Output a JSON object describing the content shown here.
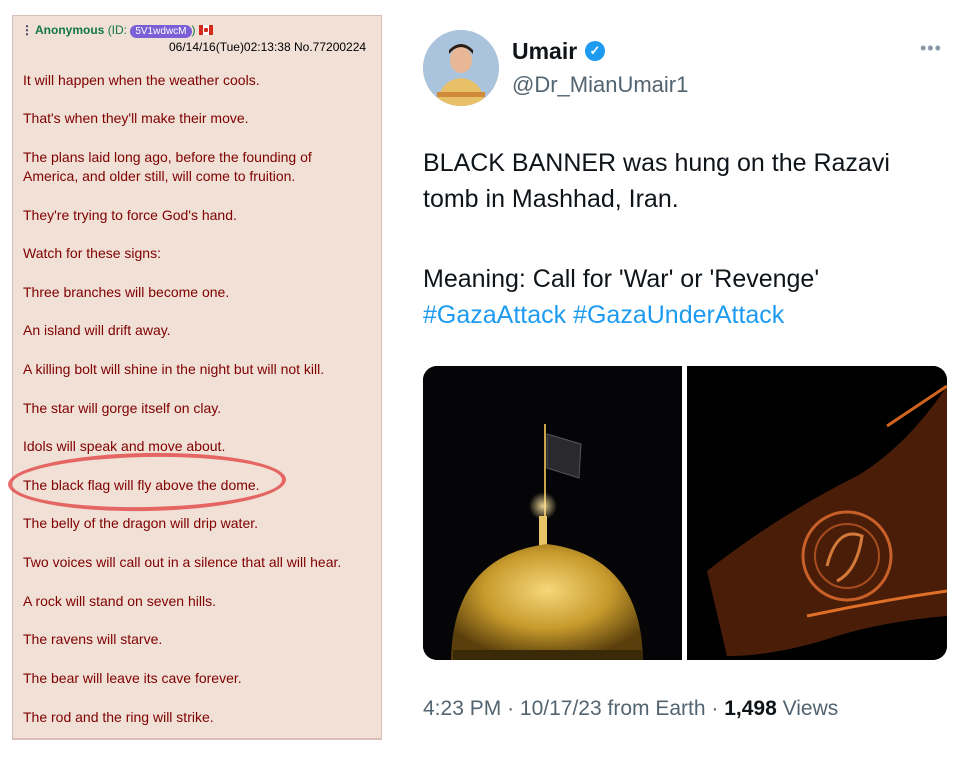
{
  "post": {
    "name": "Anonymous",
    "id_label": "(ID:",
    "id": "5V1wdwcM",
    "id_close": ")",
    "datetime": "06/14/16(Tue)02:13:38",
    "number": "No.77200224",
    "lines": [
      "It will happen when the weather cools.",
      "That's when they'll make their move.",
      "The plans laid long ago, before the founding of America, and older still, will come to fruition.",
      "They're trying to force God's hand.",
      "Watch for these signs:",
      "Three branches will become one.",
      "An island will drift away.",
      "A killing bolt will shine in the night but will not kill.",
      "The star will gorge itself on clay.",
      "Idols will speak and move about.",
      "The black flag will fly above the dome.",
      "The belly of the dragon will drip water.",
      "Two voices will call out in a silence that all will hear.",
      "A rock will stand on seven hills.",
      "The ravens will starve.",
      "The bear will leave its cave forever.",
      "The rod and the ring will strike."
    ]
  },
  "tweet": {
    "display_name": "Umair",
    "handle": "@Dr_MianUmair1",
    "text_line1": "BLACK BANNER was hung on the Razavi tomb in Mashhad, Iran.",
    "text_line2": "Meaning: Call for 'War' or 'Revenge'",
    "hashtags": "#GazaAttack #GazaUnderAttack",
    "time": "4:23 PM",
    "date": "10/17/23",
    "source": "from Earth",
    "views_count": "1,498",
    "views_label": "Views",
    "separator": "·"
  },
  "colors": {
    "post_bg": "#f0e0d6",
    "post_text": "#800000",
    "name_green": "#117743",
    "twitter_blue": "#1d9bf0",
    "highlight_circle": "#e13c3c"
  },
  "icons": [
    "drag-handle-icon",
    "canada-flag-icon",
    "verified-badge-icon",
    "more-options-icon"
  ]
}
